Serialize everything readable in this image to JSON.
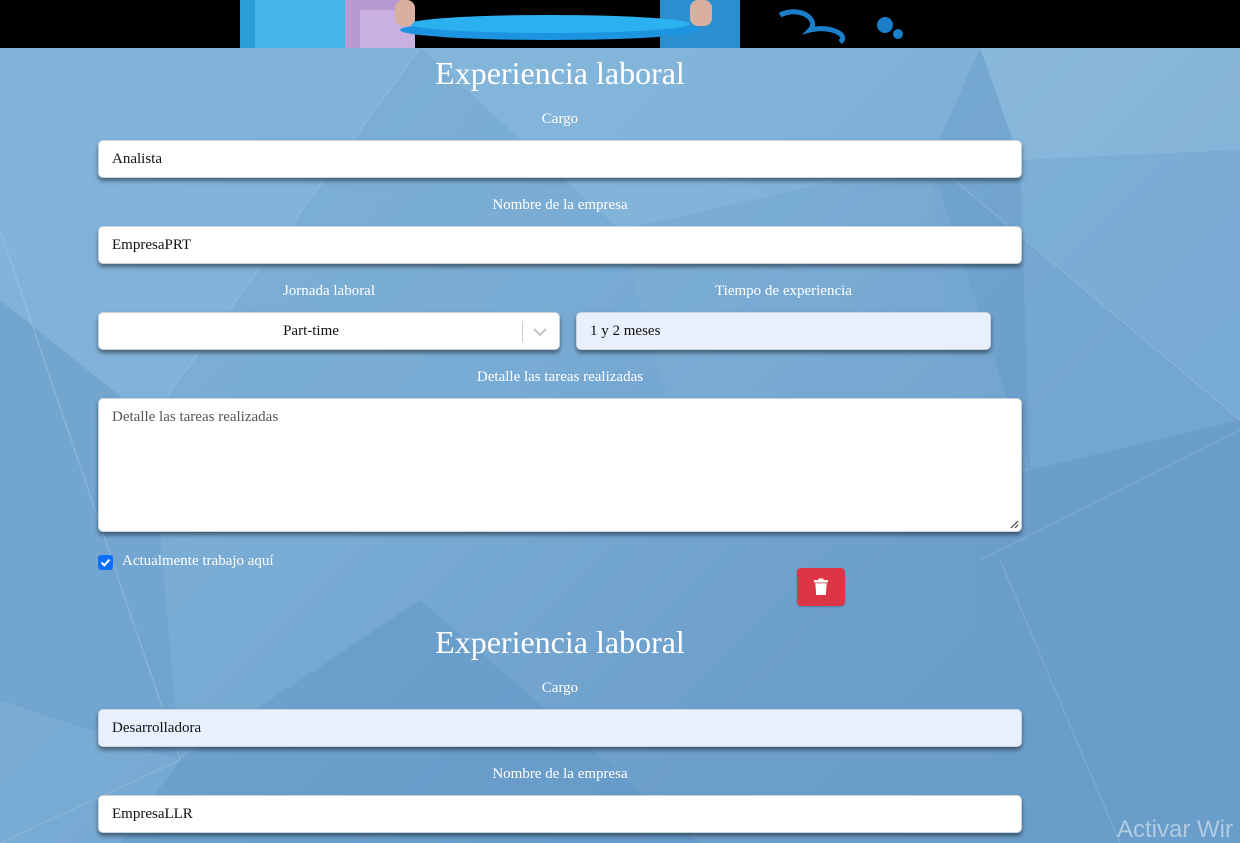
{
  "sections": [
    {
      "title": "Experiencia laboral",
      "cargo_label": "Cargo",
      "cargo_value": "Analista",
      "empresa_label": "Nombre de la empresa",
      "empresa_value": "EmpresaPRT",
      "jornada_label": "Jornada laboral",
      "jornada_value": "Part-time",
      "tiempo_label": "Tiempo de experiencia",
      "tiempo_value": "1 y 2 meses",
      "tareas_label": "Detalle las tareas realizadas",
      "tareas_placeholder": "Detalle las tareas realizadas",
      "actual_label": "Actualmente trabajo aquí",
      "actual_checked": true
    },
    {
      "title": "Experiencia laboral",
      "cargo_label": "Cargo",
      "cargo_value": "Desarrolladora",
      "empresa_label": "Nombre de la empresa",
      "empresa_value": "EmpresaLLR"
    }
  ],
  "icons": {
    "delete": "trash-icon",
    "select": "chevron-down-icon",
    "checkbox": "checkmark-icon"
  },
  "colors": {
    "delete_button": "#dc3545",
    "checkbox": "#0d6efd",
    "autofill_field": "#e8f0fd"
  },
  "watermark": "Activar Wir"
}
